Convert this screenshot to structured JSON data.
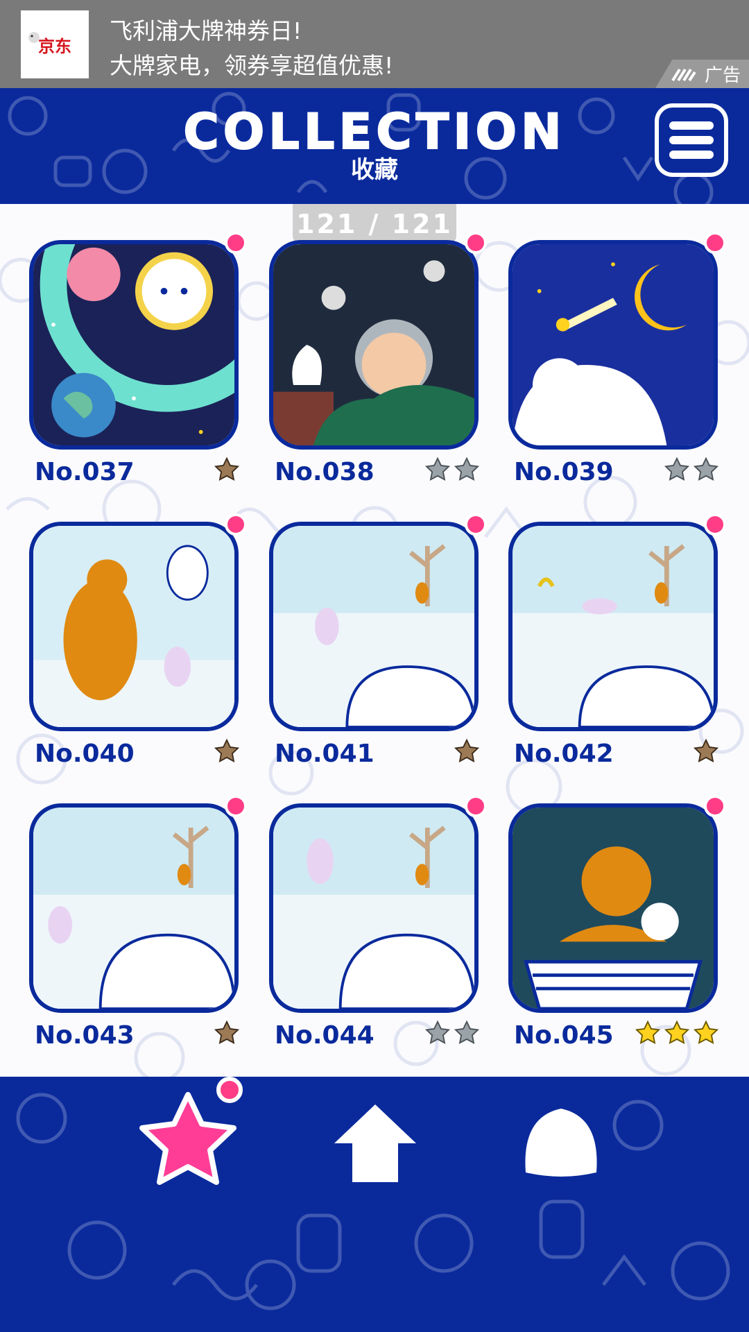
{
  "ad": {
    "brand_logo_text": "京东",
    "line1": "飞利浦大牌神券日!",
    "line2": "大牌家电，领券享超值优惠!",
    "tag": "广告"
  },
  "header": {
    "title": "COLLECTION",
    "subtitle": "收藏"
  },
  "counter": "121 / 121",
  "items": [
    {
      "number": "No.037",
      "stars": 1,
      "star_color": "bronze",
      "new": true,
      "scene": "space-planet"
    },
    {
      "number": "No.038",
      "stars": 2,
      "star_color": "silver",
      "new": true,
      "scene": "space-helmet"
    },
    {
      "number": "No.039",
      "stars": 2,
      "star_color": "silver",
      "new": true,
      "scene": "night-moon"
    },
    {
      "number": "No.040",
      "stars": 1,
      "star_color": "bronze",
      "new": true,
      "scene": "bear-skating"
    },
    {
      "number": "No.041",
      "stars": 1,
      "star_color": "bronze",
      "new": true,
      "scene": "snow-skater"
    },
    {
      "number": "No.042",
      "stars": 1,
      "star_color": "bronze",
      "new": true,
      "scene": "snow-fall"
    },
    {
      "number": "No.043",
      "stars": 1,
      "star_color": "bronze",
      "new": true,
      "scene": "snow-skater-left"
    },
    {
      "number": "No.044",
      "stars": 2,
      "star_color": "silver",
      "new": true,
      "scene": "snow-dance"
    },
    {
      "number": "No.045",
      "stars": 3,
      "star_color": "gold",
      "new": true,
      "scene": "bear-car"
    }
  ],
  "nav": {
    "items": [
      "star-icon",
      "home-icon",
      "character-icon"
    ],
    "active": "star-icon",
    "badge": true
  },
  "colors": {
    "brand_blue": "#0a2a9c",
    "badge_pink": "#ff3d86",
    "star_bronze": "#9c7a56",
    "star_silver": "#9aa3a8",
    "star_gold": "#ffd21f"
  }
}
